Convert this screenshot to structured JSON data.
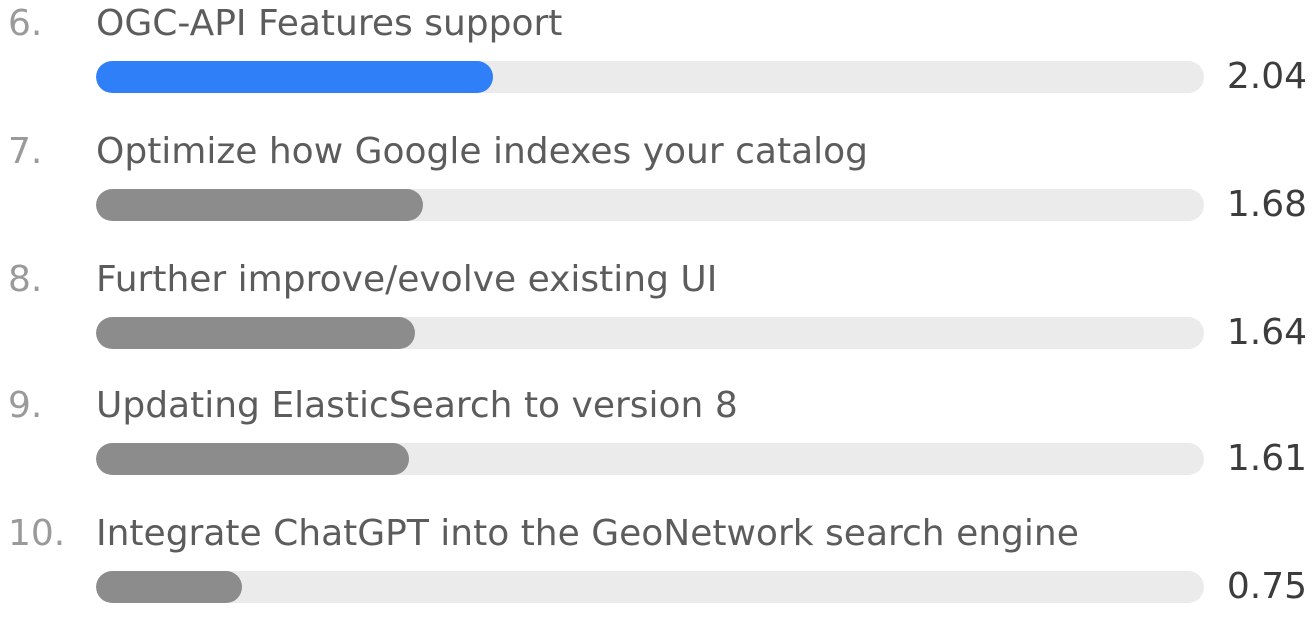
{
  "chart_data": {
    "type": "bar",
    "orientation": "horizontal",
    "ranks": [
      "6.",
      "7.",
      "8.",
      "9.",
      "10."
    ],
    "categories": [
      "OGC-API Features support",
      "Optimize how Google indexes your catalog",
      "Further improve/evolve existing UI",
      "Updating ElasticSearch to version 8",
      "Integrate ChatGPT into the GeoNetwork search engine"
    ],
    "values": [
      2.04,
      1.68,
      1.64,
      1.61,
      0.75
    ],
    "value_labels": [
      "2.04",
      "1.68",
      "1.64",
      "1.61",
      "0.75"
    ],
    "xlim": [
      0,
      5.7
    ],
    "grid": false,
    "legend": "none",
    "highlight_index": 0
  },
  "colors": {
    "highlight": "#2f7ff8",
    "bar": "#8c8c8c",
    "track": "#ebebeb",
    "rank_text": "#9a9a9a",
    "label_text": "#5c5c5c",
    "value_text": "#3c3c3c"
  }
}
